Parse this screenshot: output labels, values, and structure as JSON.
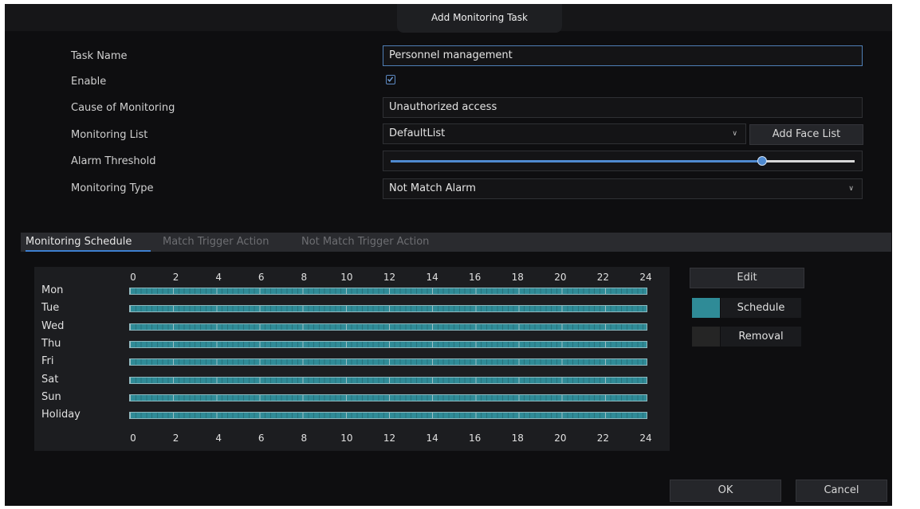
{
  "dialog": {
    "title": "Add Monitoring Task"
  },
  "form": {
    "task_name_label": "Task Name",
    "task_name_value": "Personnel management",
    "enable_label": "Enable",
    "enable_checked": true,
    "cause_label": "Cause of Monitoring",
    "cause_value": "Unauthorized access",
    "list_label": "Monitoring List",
    "list_value": "DefaultList",
    "add_face_list_button": "Add Face List",
    "threshold_label": "Alarm Threshold",
    "threshold_value_fraction": 0.8,
    "type_label": "Monitoring Type",
    "type_value": "Not Match Alarm"
  },
  "tabs": [
    {
      "label": "Monitoring Schedule",
      "active": true
    },
    {
      "label": "Match Trigger Action",
      "active": false
    },
    {
      "label": "Not Match Trigger Action",
      "active": false
    }
  ],
  "schedule": {
    "hours": [
      "0",
      "2",
      "4",
      "6",
      "8",
      "10",
      "12",
      "14",
      "16",
      "18",
      "20",
      "22",
      "24"
    ],
    "days": [
      "Mon",
      "Tue",
      "Wed",
      "Thu",
      "Fri",
      "Sat",
      "Sun",
      "Holiday"
    ],
    "edit_button": "Edit",
    "legend_schedule": "Schedule",
    "legend_removal": "Removal",
    "schedule_color": "#2f8b97",
    "removal_color": "#252525"
  },
  "footer": {
    "ok_button": "OK",
    "cancel_button": "Cancel"
  }
}
